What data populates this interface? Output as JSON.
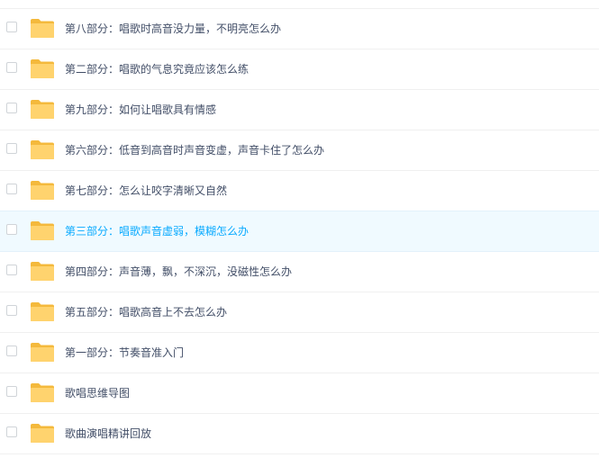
{
  "colors": {
    "folder_fill": "#ffd36e",
    "folder_back": "#f4b93c",
    "selected_text": "#09aaff",
    "selected_background": "#f0faff",
    "text": "#424e67"
  },
  "file_list": {
    "icon": "folder-icon",
    "selected_index": 5,
    "items": [
      {
        "name": "第八部分：唱歌时高音没力量，不明亮怎么办"
      },
      {
        "name": "第二部分：唱歌的气息究竟应该怎么练"
      },
      {
        "name": "第九部分：如何让唱歌具有情感"
      },
      {
        "name": "第六部分：低音到高音时声音变虚，声音卡住了怎么办"
      },
      {
        "name": "第七部分：怎么让咬字清晰又自然"
      },
      {
        "name": "第三部分：唱歌声音虚弱，模糊怎么办"
      },
      {
        "name": "第四部分：声音薄，飘，不深沉，没磁性怎么办"
      },
      {
        "name": "第五部分：唱歌高音上不去怎么办"
      },
      {
        "name": "第一部分：节奏音准入门"
      },
      {
        "name": "歌唱思维导图"
      },
      {
        "name": "歌曲演唱精讲回放"
      }
    ]
  }
}
